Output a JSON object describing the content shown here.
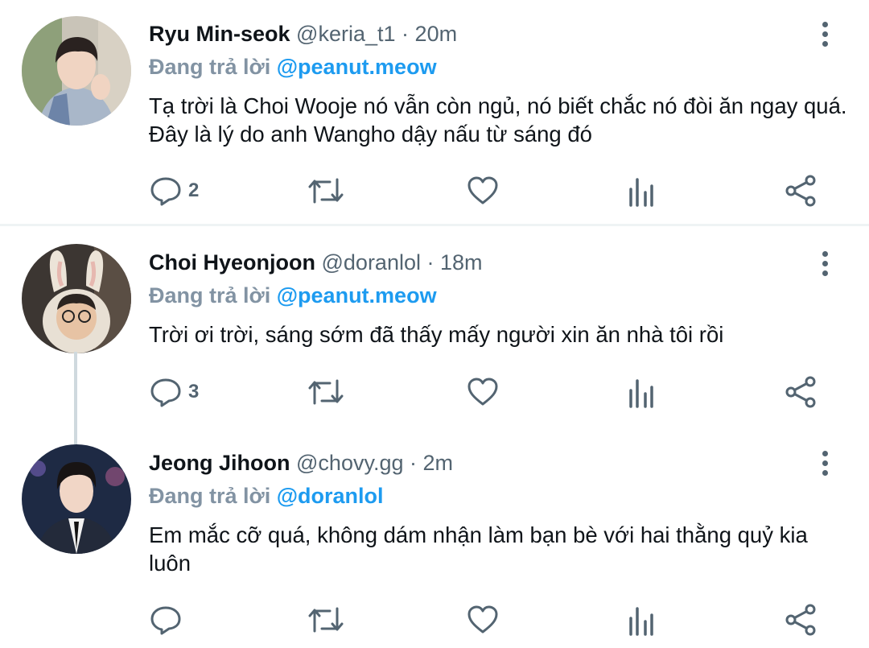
{
  "colors": {
    "accent": "#1d9bf0",
    "muted": "#536471",
    "reply_prefix": "#8293a3",
    "text": "#0f1419"
  },
  "tweets": [
    {
      "display_name": "Ryu Min-seok",
      "handle": "@keria_t1",
      "separator": "·",
      "time": "20m",
      "reply_prefix": "Đang trả lời ",
      "reply_to": "@peanut.meow",
      "text": "Tạ trời là Choi Wooje nó vẫn còn ngủ, nó biết chắc nó đòi ăn ngay quá. Đây là lý do anh Wangho dậy nấu từ sáng đó",
      "reply_count": "2",
      "avatar_icon": "avatar-photo"
    },
    {
      "display_name": "Choi Hyeonjoon",
      "handle": "@doranlol",
      "separator": "·",
      "time": "18m",
      "reply_prefix": "Đang trả lời ",
      "reply_to": "@peanut.meow",
      "text": "Trời ơi trời, sáng sớm đã thấy mấy người xin ăn nhà tôi rồi",
      "reply_count": "3",
      "avatar_icon": "avatar-photo"
    },
    {
      "display_name": "Jeong Jihoon",
      "handle": "@chovy.gg",
      "separator": "·",
      "time": "2m",
      "reply_prefix": "Đang trả lời ",
      "reply_to": "@doranlol",
      "text": "Em mắc cỡ quá, không dám nhận làm bạn bè với hai thằng quỷ kia luôn",
      "reply_count": "",
      "avatar_icon": "avatar-photo"
    }
  ],
  "action_icons": [
    "reply-icon",
    "retweet-icon",
    "like-icon",
    "analytics-icon",
    "share-icon"
  ]
}
